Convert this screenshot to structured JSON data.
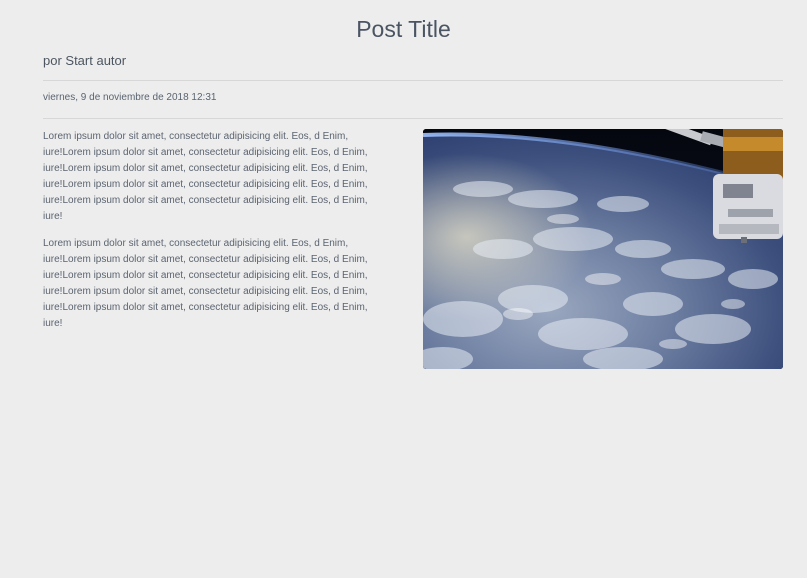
{
  "post": {
    "title": "Post Title",
    "author": "por Start autor",
    "date": "viernes, 9 de noviembre de 2018 12:31",
    "paragraphs": [
      "Lorem ipsum dolor sit amet, consectetur adipisicing elit. Eos, d Enim, iure!Lorem ipsum dolor sit amet, consectetur adipisicing elit. Eos, d Enim, iure!Lorem ipsum dolor sit amet, consectetur adipisicing elit. Eos, d Enim, iure!Lorem ipsum dolor sit amet, consectetur adipisicing elit. Eos, d Enim, iure!Lorem ipsum dolor sit amet, consectetur adipisicing elit. Eos, d Enim, iure!",
      "Lorem ipsum dolor sit amet, consectetur adipisicing elit. Eos, d Enim, iure!Lorem ipsum dolor sit amet, consectetur adipisicing elit. Eos, d Enim, iure!Lorem ipsum dolor sit amet, consectetur adipisicing elit. Eos, d Enim, iure!Lorem ipsum dolor sit amet, consectetur adipisicing elit. Eos, d Enim, iure!Lorem ipsum dolor sit amet, consectetur adipisicing elit. Eos, d Enim, iure!"
    ],
    "image": {
      "subject": "earth-from-space-station-photo"
    }
  },
  "colors": {
    "background": "#ededed",
    "text": "#5b6470",
    "divider": "#d7d7d7"
  }
}
